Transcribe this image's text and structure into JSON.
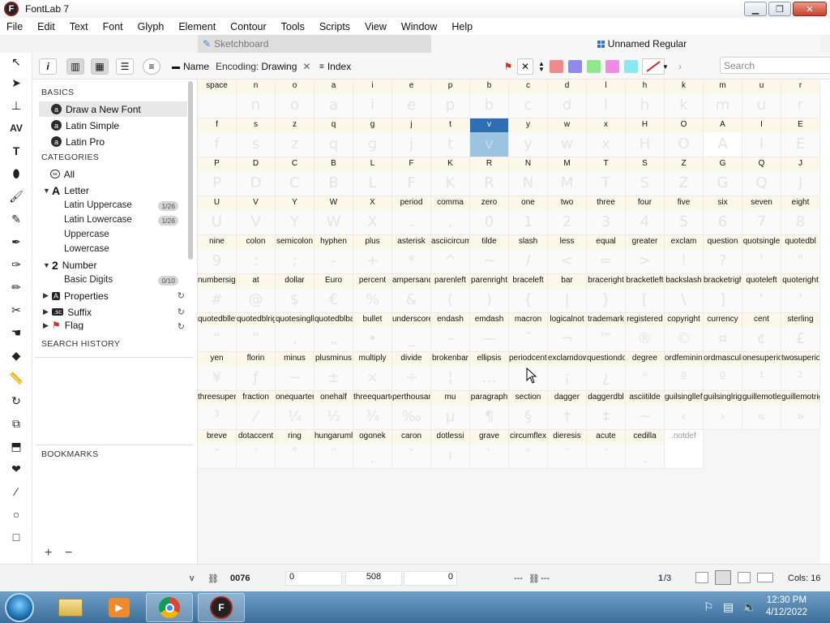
{
  "window": {
    "title": "FontLab 7"
  },
  "menu": [
    "File",
    "Edit",
    "Text",
    "Font",
    "Glyph",
    "Element",
    "Contour",
    "Tools",
    "Scripts",
    "View",
    "Window",
    "Help"
  ],
  "tabs": {
    "sketchboard": "Sketchboard",
    "font": "Unnamed Regular"
  },
  "controls": {
    "name_label": "Name",
    "encoding_label": "Encoding:",
    "encoding_value": "Drawing",
    "index_label": "Index",
    "search_placeholder": "Search",
    "swatches": [
      "#ef8a8a",
      "#8a8aef",
      "#8fe88f",
      "#f08ae8",
      "#8ae8ef"
    ]
  },
  "sidebar": {
    "basics_heading": "BASICS",
    "basics": [
      "Draw a New Font",
      "Latin Simple",
      "Latin Pro"
    ],
    "categories_heading": "CATEGORIES",
    "all": "All",
    "letter": "Letter",
    "letter_sub": [
      {
        "label": "Latin Uppercase",
        "badge": "1/26"
      },
      {
        "label": "Latin Lowercase",
        "badge": "1/26"
      },
      {
        "label": "Uppercase",
        "badge": ""
      },
      {
        "label": "Lowercase",
        "badge": ""
      }
    ],
    "number": "Number",
    "number_sub": [
      {
        "label": "Basic Digits",
        "badge": "0/10"
      }
    ],
    "properties": "Properties",
    "suffix": "Suffix",
    "flag": "Flag",
    "search_history_heading": "SEARCH HISTORY",
    "bookmarks_heading": "BOOKMARKS"
  },
  "grid": {
    "selected_glyph": "v",
    "cells": [
      [
        "space",
        ""
      ],
      [
        "n",
        "n"
      ],
      [
        "o",
        "o"
      ],
      [
        "a",
        "a"
      ],
      [
        "i",
        "i"
      ],
      [
        "e",
        "e"
      ],
      [
        "p",
        "p"
      ],
      [
        "b",
        "b"
      ],
      [
        "c",
        "c"
      ],
      [
        "d",
        "d"
      ],
      [
        "l",
        "l"
      ],
      [
        "h",
        "h"
      ],
      [
        "k",
        "k"
      ],
      [
        "m",
        "m"
      ],
      [
        "u",
        "u"
      ],
      [
        "r",
        "r"
      ],
      [
        "f",
        "f"
      ],
      [
        "s",
        "s"
      ],
      [
        "z",
        "z"
      ],
      [
        "q",
        "q"
      ],
      [
        "g",
        "g"
      ],
      [
        "j",
        "j"
      ],
      [
        "t",
        "t"
      ],
      [
        "v",
        "v"
      ],
      [
        "y",
        "y"
      ],
      [
        "w",
        "w"
      ],
      [
        "x",
        "x"
      ],
      [
        "H",
        "H"
      ],
      [
        "O",
        "O"
      ],
      [
        "A",
        "A"
      ],
      [
        "I",
        "I"
      ],
      [
        "E",
        "E"
      ],
      [
        "P",
        "P"
      ],
      [
        "D",
        "D"
      ],
      [
        "C",
        "C"
      ],
      [
        "B",
        "B"
      ],
      [
        "L",
        "L"
      ],
      [
        "F",
        "F"
      ],
      [
        "K",
        "K"
      ],
      [
        "R",
        "R"
      ],
      [
        "N",
        "N"
      ],
      [
        "M",
        "M"
      ],
      [
        "T",
        "T"
      ],
      [
        "S",
        "S"
      ],
      [
        "Z",
        "Z"
      ],
      [
        "G",
        "G"
      ],
      [
        "Q",
        "Q"
      ],
      [
        "J",
        "J"
      ],
      [
        "U",
        "U"
      ],
      [
        "V",
        "V"
      ],
      [
        "Y",
        "Y"
      ],
      [
        "W",
        "W"
      ],
      [
        "X",
        "X"
      ],
      [
        "period",
        "."
      ],
      [
        "comma",
        ","
      ],
      [
        "zero",
        "0"
      ],
      [
        "one",
        "1"
      ],
      [
        "two",
        "2"
      ],
      [
        "three",
        "3"
      ],
      [
        "four",
        "4"
      ],
      [
        "five",
        "5"
      ],
      [
        "six",
        "6"
      ],
      [
        "seven",
        "7"
      ],
      [
        "eight",
        "8"
      ],
      [
        "nine",
        "9"
      ],
      [
        "colon",
        ":"
      ],
      [
        "semicolon",
        ";"
      ],
      [
        "hyphen",
        "-"
      ],
      [
        "plus",
        "+"
      ],
      [
        "asterisk",
        "*"
      ],
      [
        "asciicircum",
        "^"
      ],
      [
        "tilde",
        "~"
      ],
      [
        "slash",
        "/"
      ],
      [
        "less",
        "<"
      ],
      [
        "equal",
        "="
      ],
      [
        "greater",
        ">"
      ],
      [
        "exclam",
        "!"
      ],
      [
        "question",
        "?"
      ],
      [
        "quotsingle",
        "'"
      ],
      [
        "quotedbl",
        "\""
      ],
      [
        "numbersign",
        "#"
      ],
      [
        "at",
        "@"
      ],
      [
        "dollar",
        "$"
      ],
      [
        "Euro",
        "€"
      ],
      [
        "percent",
        "%"
      ],
      [
        "ampersand",
        "&"
      ],
      [
        "parenleft",
        "("
      ],
      [
        "parenright",
        ")"
      ],
      [
        "braceleft",
        "{"
      ],
      [
        "bar",
        "|"
      ],
      [
        "braceright",
        "}"
      ],
      [
        "bracketleft",
        "["
      ],
      [
        "backslash",
        "\\"
      ],
      [
        "bracketright",
        "]"
      ],
      [
        "quoteleft",
        "‘"
      ],
      [
        "quoteright",
        "’"
      ],
      [
        "quotedblleft",
        "“"
      ],
      [
        "quotedblright",
        "”"
      ],
      [
        "quotesinglbase",
        "‚"
      ],
      [
        "quotedblbase",
        "„"
      ],
      [
        "bullet",
        "•"
      ],
      [
        "underscore",
        "_"
      ],
      [
        "endash",
        "–"
      ],
      [
        "emdash",
        "—"
      ],
      [
        "macron",
        "¯"
      ],
      [
        "logicalnot",
        "¬"
      ],
      [
        "trademark",
        "™"
      ],
      [
        "registered",
        "®"
      ],
      [
        "copyright",
        "©"
      ],
      [
        "currency",
        "¤"
      ],
      [
        "cent",
        "¢"
      ],
      [
        "sterling",
        "£"
      ],
      [
        "yen",
        "¥"
      ],
      [
        "florin",
        "ƒ"
      ],
      [
        "minus",
        "−"
      ],
      [
        "plusminus",
        "±"
      ],
      [
        "multiply",
        "×"
      ],
      [
        "divide",
        "÷"
      ],
      [
        "brokenbar",
        "¦"
      ],
      [
        "ellipsis",
        "…"
      ],
      [
        "periodcentered",
        "·"
      ],
      [
        "exclamdown",
        "¡"
      ],
      [
        "questiondown",
        "¿"
      ],
      [
        "degree",
        "°"
      ],
      [
        "ordfeminine",
        "ª"
      ],
      [
        "ordmasculine",
        "º"
      ],
      [
        "onesuperior",
        "¹"
      ],
      [
        "twosuperior",
        "²"
      ],
      [
        "threesuperior",
        "³"
      ],
      [
        "fraction",
        "⁄"
      ],
      [
        "onequarter",
        "¼"
      ],
      [
        "onehalf",
        "½"
      ],
      [
        "threequarters",
        "¾"
      ],
      [
        "perthousand",
        "‰"
      ],
      [
        "mu",
        "µ"
      ],
      [
        "paragraph",
        "¶"
      ],
      [
        "section",
        "§"
      ],
      [
        "dagger",
        "†"
      ],
      [
        "daggerdbl",
        "‡"
      ],
      [
        "asciitilde",
        "~"
      ],
      [
        "guilsinglleft",
        "‹"
      ],
      [
        "guilsinglright",
        "›"
      ],
      [
        "guillemotleft",
        "«"
      ],
      [
        "guillemotright",
        "»"
      ],
      [
        "breve",
        "˘"
      ],
      [
        "dotaccent",
        "˙"
      ],
      [
        "ring",
        "˚"
      ],
      [
        "hungarumlaut",
        "˝"
      ],
      [
        "ogonek",
        "˛"
      ],
      [
        "caron",
        "ˇ"
      ],
      [
        "dotlessi",
        "ı"
      ],
      [
        "grave",
        "`"
      ],
      [
        "circumflex",
        "ˆ"
      ],
      [
        "dieresis",
        "¨"
      ],
      [
        "acute",
        "´"
      ],
      [
        "cedilla",
        "¸"
      ],
      [
        ".notdef",
        ""
      ]
    ]
  },
  "status": {
    "glyph_name": "v",
    "unicode": "0076",
    "left_sb": "0",
    "width": "508",
    "right_sb": "0",
    "dash1": "---",
    "dash2": "---",
    "page_current": "1",
    "page_total": "/3",
    "cols": "Cols: 16"
  },
  "taskbar": {
    "time": "12:30 PM",
    "date": "4/12/2022"
  }
}
